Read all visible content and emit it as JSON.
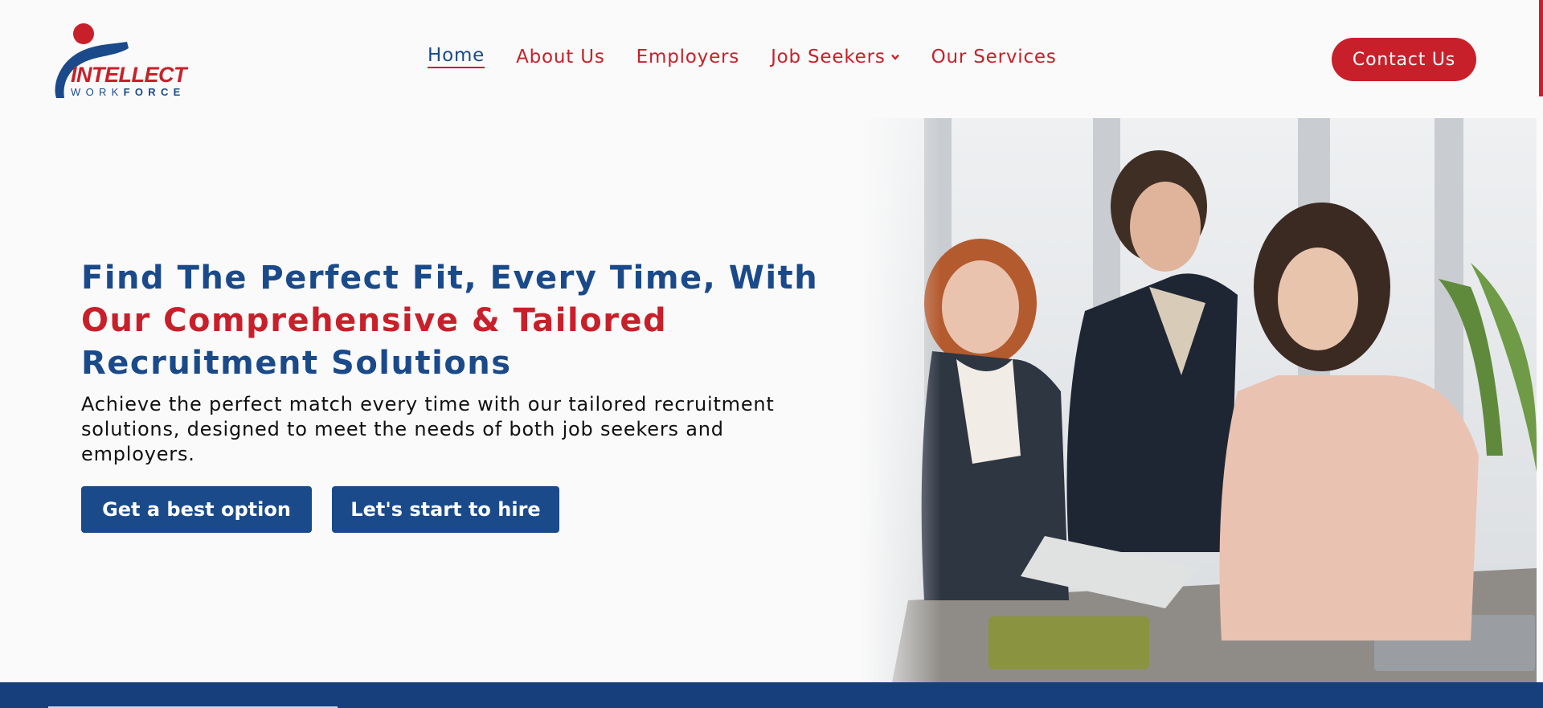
{
  "logo": {
    "name": "INTELLECT",
    "sub_1": "WORK",
    "sub_2": "FORCE"
  },
  "nav": {
    "items": [
      {
        "label": "Home"
      },
      {
        "label": "About Us"
      },
      {
        "label": "Employers"
      },
      {
        "label": "Job Seekers"
      },
      {
        "label": "Our Services"
      }
    ]
  },
  "header": {
    "contact_label": "Contact Us"
  },
  "hero": {
    "title_part1": "Find The Perfect Fit, Every Time, With",
    "title_part2": "Our Comprehensive & Tailored",
    "title_part3": "Recruitment Solutions",
    "subtitle": "Achieve the perfect match every time with our tailored recruitment solutions, designed to meet the needs of both job seekers and employers.",
    "button1": "Get a best option",
    "button2": "Let's start to hire"
  },
  "icons": {
    "dropdown": "chevron-down-icon",
    "photo": "team-meeting-photo"
  },
  "colors": {
    "brand_red": "#c8202a",
    "brand_blue": "#1a4a8a",
    "band_blue": "#173f7c",
    "background": "#fafafa"
  }
}
